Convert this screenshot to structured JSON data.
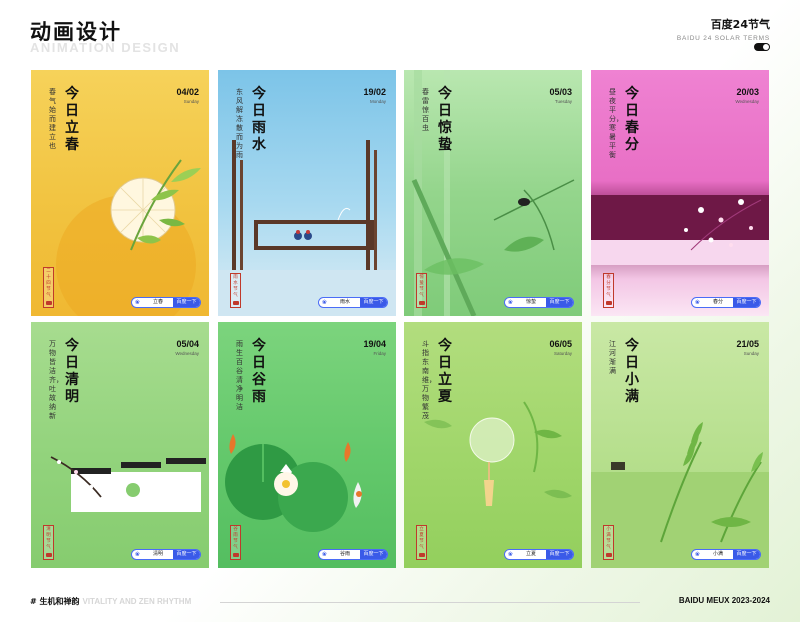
{
  "header": {
    "title": "动画设计",
    "subtitle": "ANIMATION DESIGN",
    "right_title": "百度24节气",
    "right_sub": "BAIDU 24 SOLAR TERMS"
  },
  "cards": [
    {
      "date": "04/02",
      "weekday": "Sunday",
      "title": "今日立春",
      "poem": "春气始而建立也",
      "stamp": "二十四节气",
      "query": "立春",
      "btn": "百度一下",
      "bg": "#f3c94a"
    },
    {
      "date": "19/02",
      "weekday": "Monday",
      "title": "今日雨水",
      "poem": "东风解冻散而为雨",
      "stamp": "雨水节气",
      "query": "雨水",
      "btn": "百度一下",
      "bg": "#7ec6e8"
    },
    {
      "date": "05/03",
      "weekday": "Tuesday",
      "title": "今日惊蛰",
      "poem": "春雷惊百虫",
      "stamp": "惊蛰节气",
      "query": "惊蛰",
      "btn": "百度一下",
      "bg": "#9bd996"
    },
    {
      "date": "20/03",
      "weekday": "Wednesday",
      "title": "今日春分",
      "poem": "昼夜平分，寒暑平衡",
      "stamp": "春分节气",
      "query": "春分",
      "btn": "百度一下",
      "bg": "#ee7fd0"
    },
    {
      "date": "05/04",
      "weekday": "Wednesday",
      "title": "今日清明",
      "poem": "万物皆洁齐，吐故纳新",
      "stamp": "清明节气",
      "query": "清明",
      "btn": "百度一下",
      "bg": "#8fd27e"
    },
    {
      "date": "19/04",
      "weekday": "Friday",
      "title": "今日谷雨",
      "poem": "雨生百谷清净明洁",
      "stamp": "谷雨节气",
      "query": "谷雨",
      "btn": "百度一下",
      "bg": "#6ccf73"
    },
    {
      "date": "06/05",
      "weekday": "Saturday",
      "title": "今日立夏",
      "poem": "斗指东南维，万物繁茂",
      "stamp": "立夏节气",
      "query": "立夏",
      "btn": "百度一下",
      "bg": "#a5d96b"
    },
    {
      "date": "21/05",
      "weekday": "Sunday",
      "title": "今日小满",
      "poem": "江河渐满",
      "stamp": "小满节气",
      "query": "小满",
      "btn": "百度一下",
      "bg": "#b7de8a"
    }
  ],
  "footer": {
    "left": "# 生机和禅韵",
    "left_en": "VITALITY AND ZEN RHYTHM",
    "right": "BAIDU MEUX 2023-2024"
  }
}
